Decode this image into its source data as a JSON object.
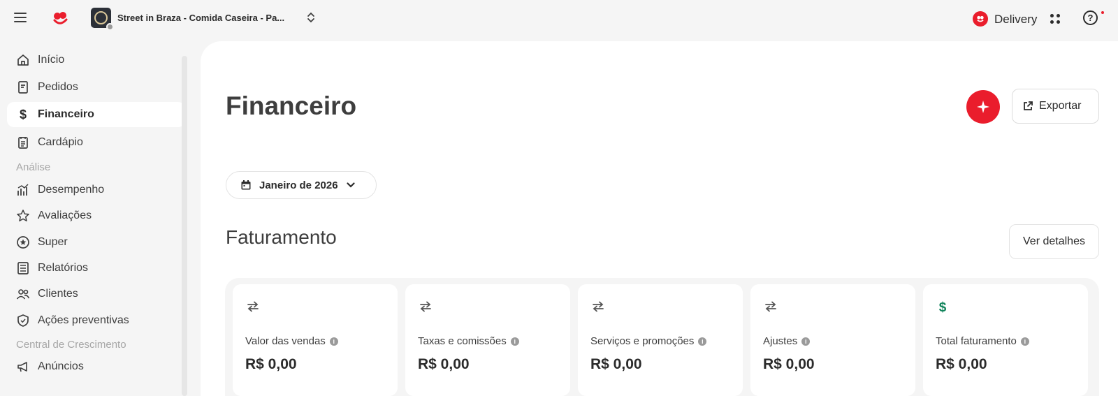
{
  "topbar": {
    "store_name": "Street in Braza - Comida Caseira - Pa...",
    "delivery_label": "Delivery",
    "help_glyph": "?"
  },
  "sidebar": {
    "items": [
      {
        "label": "Início",
        "icon": "home-icon"
      },
      {
        "label": "Pedidos",
        "icon": "receipt-icon"
      },
      {
        "label": "Financeiro",
        "icon": "dollar-icon",
        "active": true
      },
      {
        "label": "Cardápio",
        "icon": "menu-book-icon"
      }
    ],
    "section_analise": "Análise",
    "analise_items": [
      {
        "label": "Desempenho",
        "icon": "chart-icon"
      },
      {
        "label": "Avaliações",
        "icon": "star-icon"
      },
      {
        "label": "Super",
        "icon": "super-star-icon"
      },
      {
        "label": "Relatórios",
        "icon": "report-icon"
      },
      {
        "label": "Clientes",
        "icon": "people-icon"
      },
      {
        "label": "Ações preventivas",
        "icon": "shield-icon"
      }
    ],
    "section_crescimento": "Central de Crescimento",
    "crescimento_items": [
      {
        "label": "Anúncios",
        "icon": "megaphone-icon"
      }
    ]
  },
  "main": {
    "title": "Financeiro",
    "export_label": "Exportar",
    "period_label": "Janeiro de 2026",
    "section_title": "Faturamento",
    "details_label": "Ver detalhes",
    "cards": [
      {
        "label": "Valor das vendas",
        "value": "R$ 0,00",
        "icon": "transfer-icon"
      },
      {
        "label": "Taxas e comissões",
        "value": "R$ 0,00",
        "icon": "transfer-icon"
      },
      {
        "label": "Serviços e promoções",
        "value": "R$ 0,00",
        "icon": "transfer-icon"
      },
      {
        "label": "Ajustes",
        "value": "R$ 0,00",
        "icon": "transfer-icon"
      },
      {
        "label": "Total faturamento",
        "value": "R$ 0,00",
        "icon": "dollar-icon"
      }
    ]
  },
  "colors": {
    "brand_red": "#ea1d2c",
    "total_green": "#11845b"
  }
}
